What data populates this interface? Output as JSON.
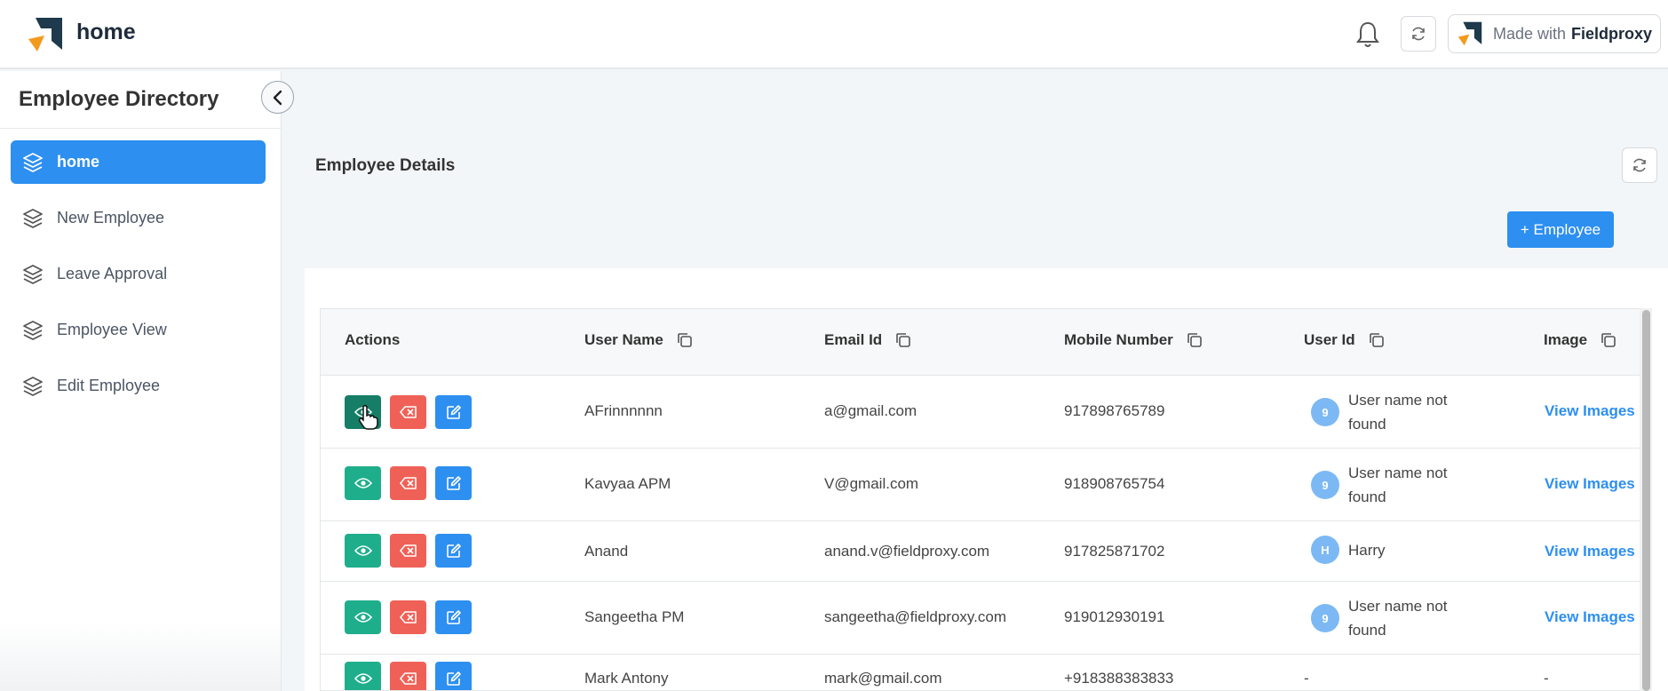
{
  "header": {
    "app_title": "home",
    "made_with_prefix": "Made with",
    "made_with_brand": "Fieldproxy"
  },
  "sidebar": {
    "title": "Employee Directory",
    "items": [
      {
        "label": "home",
        "active": true
      },
      {
        "label": "New Employee",
        "active": false
      },
      {
        "label": "Leave Approval",
        "active": false
      },
      {
        "label": "Employee View",
        "active": false
      },
      {
        "label": "Edit Employee",
        "active": false
      }
    ]
  },
  "main": {
    "section_title": "Employee Details",
    "add_button": "+ Employee",
    "columns": [
      "Actions",
      "User Name",
      "Email Id",
      "Mobile Number",
      "User Id",
      "Image"
    ],
    "rows": [
      {
        "user_name": "AFrinnnnnn",
        "email": "a@gmail.com",
        "mobile": "917898765789",
        "avatar": "9",
        "user_id": "User name not found",
        "image": "View Images"
      },
      {
        "user_name": "Kavyaa APM",
        "email": "V@gmail.com",
        "mobile": "918908765754",
        "avatar": "9",
        "user_id": "User name not found",
        "image": "View Images"
      },
      {
        "user_name": "Anand",
        "email": "anand.v@fieldproxy.com",
        "mobile": "917825871702",
        "avatar": "H",
        "user_id": "Harry",
        "image": "View Images"
      },
      {
        "user_name": "Sangeetha PM",
        "email": "sangeetha@fieldproxy.com",
        "mobile": "919012930191",
        "avatar": "9",
        "user_id": "User name not found",
        "image": "View Images"
      },
      {
        "user_name": "Mark Antony",
        "email": "mark@gmail.com",
        "mobile": "+918388383833",
        "avatar": "",
        "user_id": "-",
        "image": "-"
      }
    ]
  },
  "colors": {
    "primary": "#2d8ff0",
    "view_button": "#1fae8c",
    "delete_button": "#ef6157",
    "brand_dark": "#1e3a4c",
    "brand_orange": "#f39a1e"
  },
  "icons": {
    "logo": "fieldproxy-logo",
    "notifications": "bell-icon",
    "refresh": "refresh-icon",
    "nav": "layers-icon",
    "collapse": "chevron-left-icon",
    "copy": "copy-icon",
    "view": "eye-icon",
    "delete": "backspace-icon",
    "edit": "edit-icon"
  }
}
